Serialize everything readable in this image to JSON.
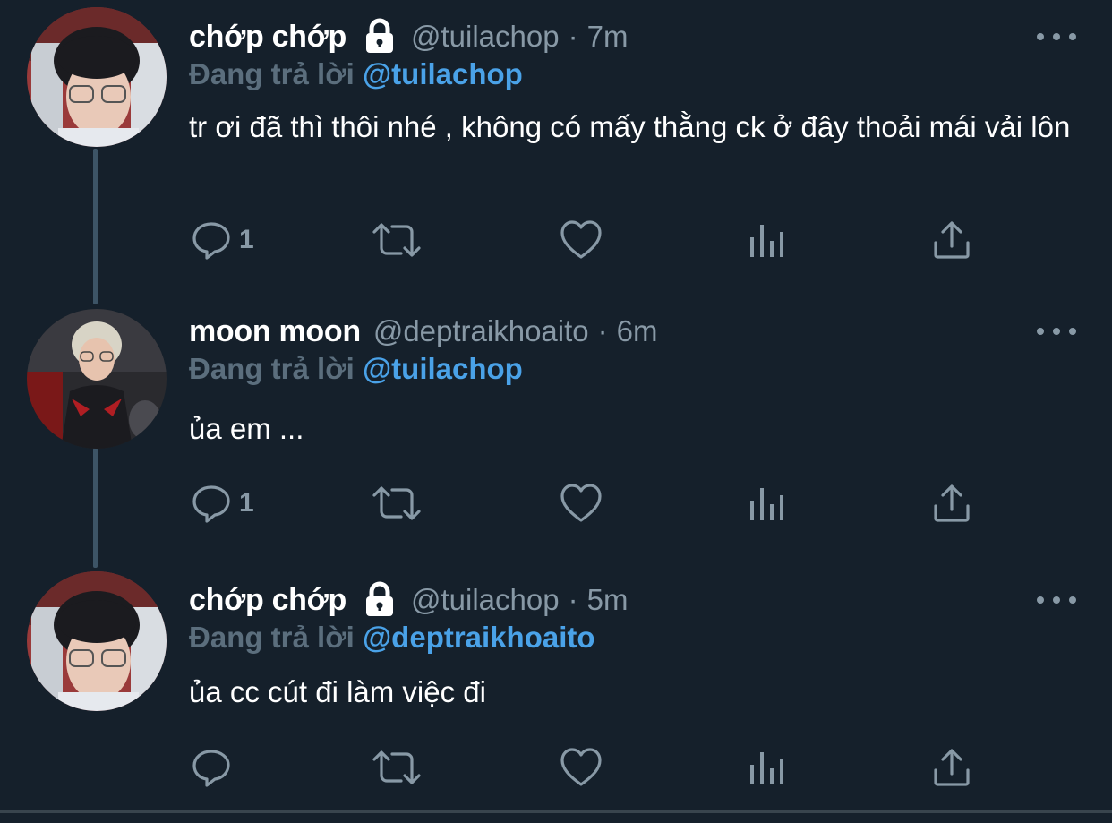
{
  "tweets": [
    {
      "display_name": "chớp chớp",
      "protected_icon": "lock-icon",
      "handle": "@tuilachop",
      "separator": "·",
      "time": "7m",
      "reply_prefix": "Đang trả lời",
      "reply_to": "@tuilachop",
      "text": "tr ơi đã thì thôi nhé , không có mấy thằng ck ở đây thoải mái vải lôn",
      "reply_count": "1",
      "icons": [
        "reply-icon",
        "retweet-icon",
        "like-icon",
        "analytics-icon",
        "share-icon"
      ]
    },
    {
      "display_name": "moon moon",
      "handle": "@deptraikhoaito",
      "separator": "·",
      "time": "6m",
      "reply_prefix": "Đang trả lời",
      "reply_to": "@tuilachop",
      "text": "ủa em ...",
      "reply_count": "1",
      "icons": [
        "reply-icon",
        "retweet-icon",
        "like-icon",
        "analytics-icon",
        "share-icon"
      ]
    },
    {
      "display_name": "chớp chớp",
      "protected_icon": "lock-icon",
      "handle": "@tuilachop",
      "separator": "·",
      "time": "5m",
      "reply_prefix": "Đang trả lời",
      "reply_to": "@deptraikhoaito",
      "text": "ủa cc cút đi làm việc đi",
      "reply_count": "",
      "icons": [
        "reply-icon",
        "retweet-icon",
        "like-icon",
        "analytics-icon",
        "share-icon"
      ]
    }
  ],
  "colors": {
    "background": "#15202b",
    "primary_text": "#ffffff",
    "secondary_text": "#8899a6",
    "mention": "#4aa2e8",
    "thread_line": "#3d5466"
  }
}
